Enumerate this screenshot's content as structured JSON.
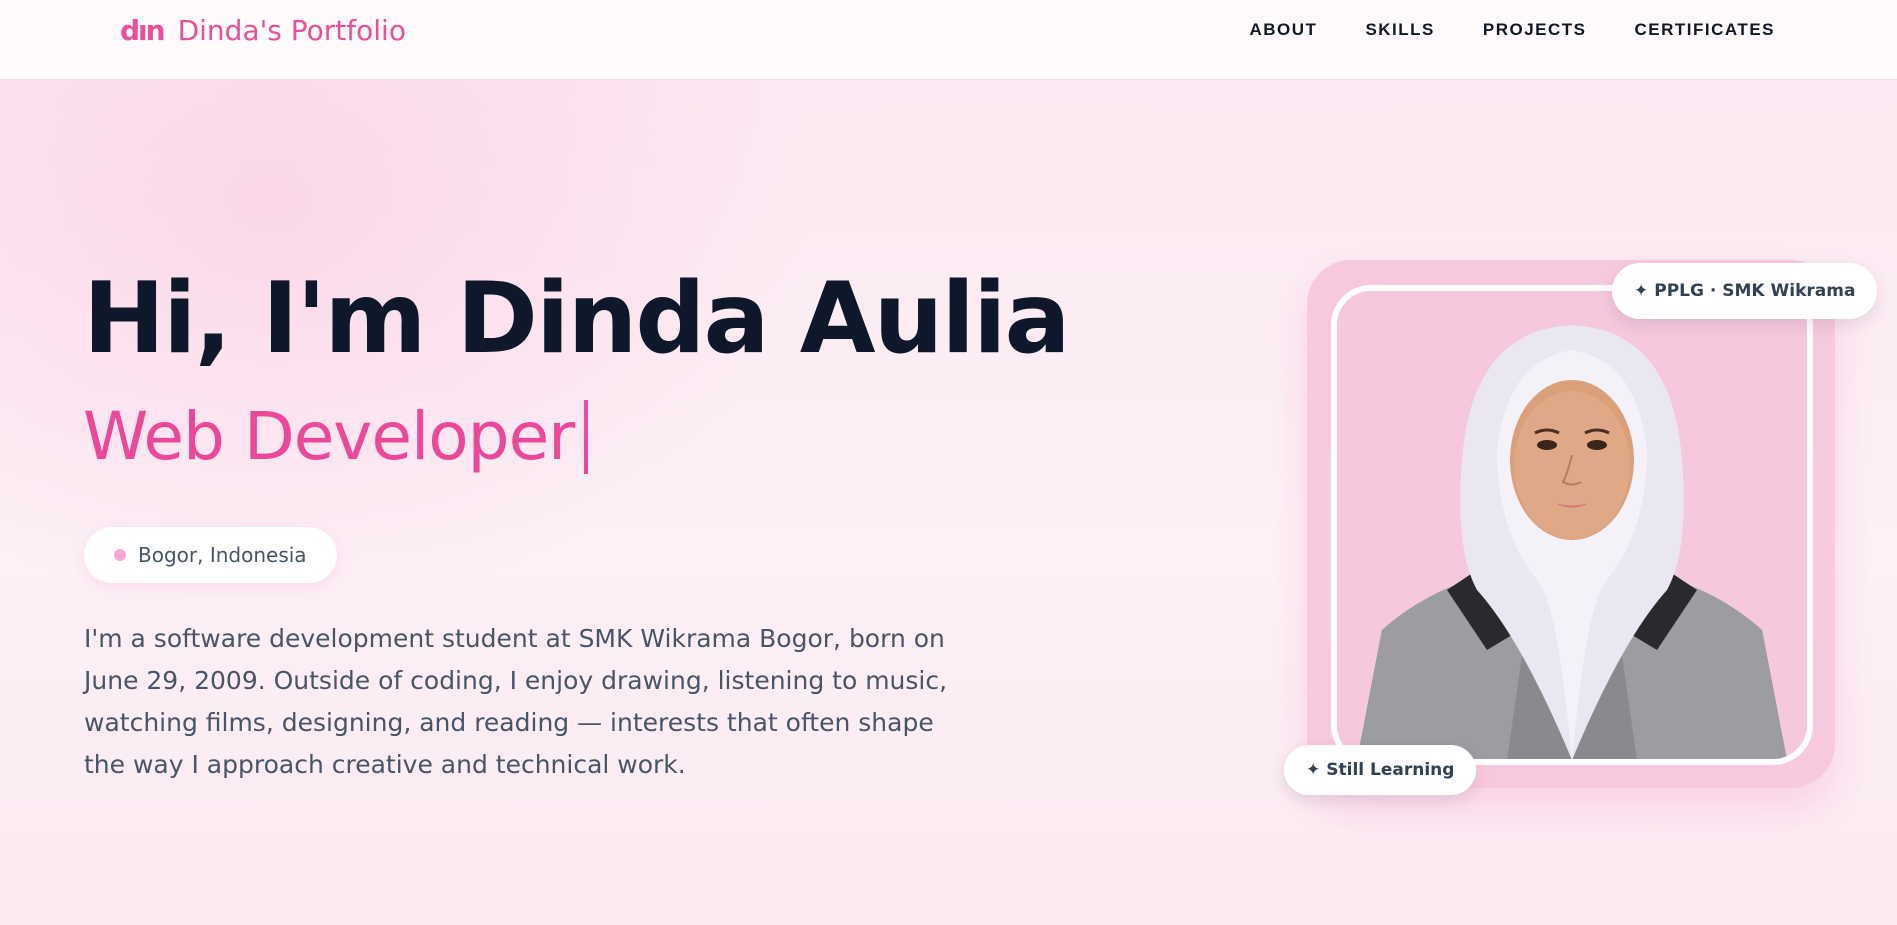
{
  "nav": {
    "logo_mark": "dın",
    "brand_name": "Dinda's Portfolio",
    "links": [
      "ABOUT",
      "SKILLS",
      "PROJECTS",
      "CERTIFICATES"
    ]
  },
  "hero": {
    "greeting": "Hi, I'm Dinda Aulia",
    "role": "Web Developer",
    "location": "Bogor, Indonesia",
    "bio": "I'm a software development student at SMK Wikrama Bogor, born on June 29, 2009. Outside of coding, I enjoy drawing, listening to music, watching films, designing, and reading — interests that often shape the way I approach creative and technical work."
  },
  "photo": {
    "badge_top": "PPLG · SMK Wikrama",
    "badge_bottom": "Still Learning",
    "badge_icon": "✦"
  },
  "colors": {
    "accent": "#ec4899",
    "heading": "#0f172a",
    "text": "#475569",
    "background": "#fce7f1"
  }
}
